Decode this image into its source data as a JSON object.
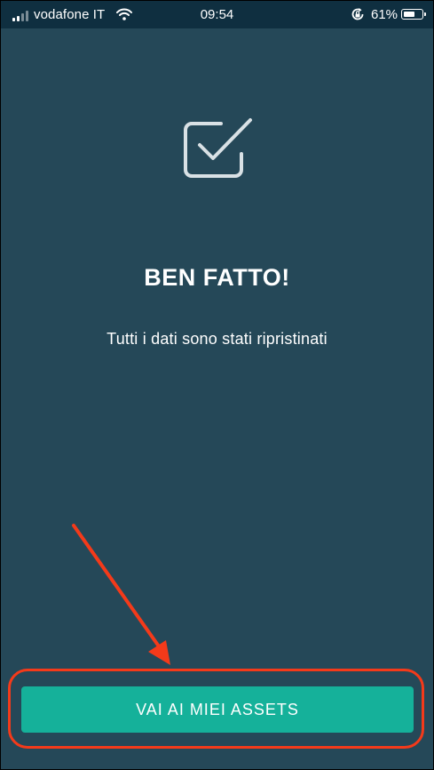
{
  "status_bar": {
    "carrier": "vodafone IT",
    "time": "09:54",
    "battery_percent": "61%",
    "battery_level": 0.61,
    "icons": [
      "signal-icon",
      "wifi-icon",
      "rotation-lock-icon",
      "battery-icon"
    ]
  },
  "main": {
    "icon": "checkbox-check-icon",
    "title": "BEN FATTO!",
    "subtitle": "Tutti i dati sono stati ripristinati",
    "button_label": "VAI AI MIEI ASSETS"
  },
  "colors": {
    "background": "#254858",
    "status_bar_background": "#0f2f40",
    "button": "#15b19a",
    "annotation": "#f43a1a",
    "text": "#ffffff"
  }
}
